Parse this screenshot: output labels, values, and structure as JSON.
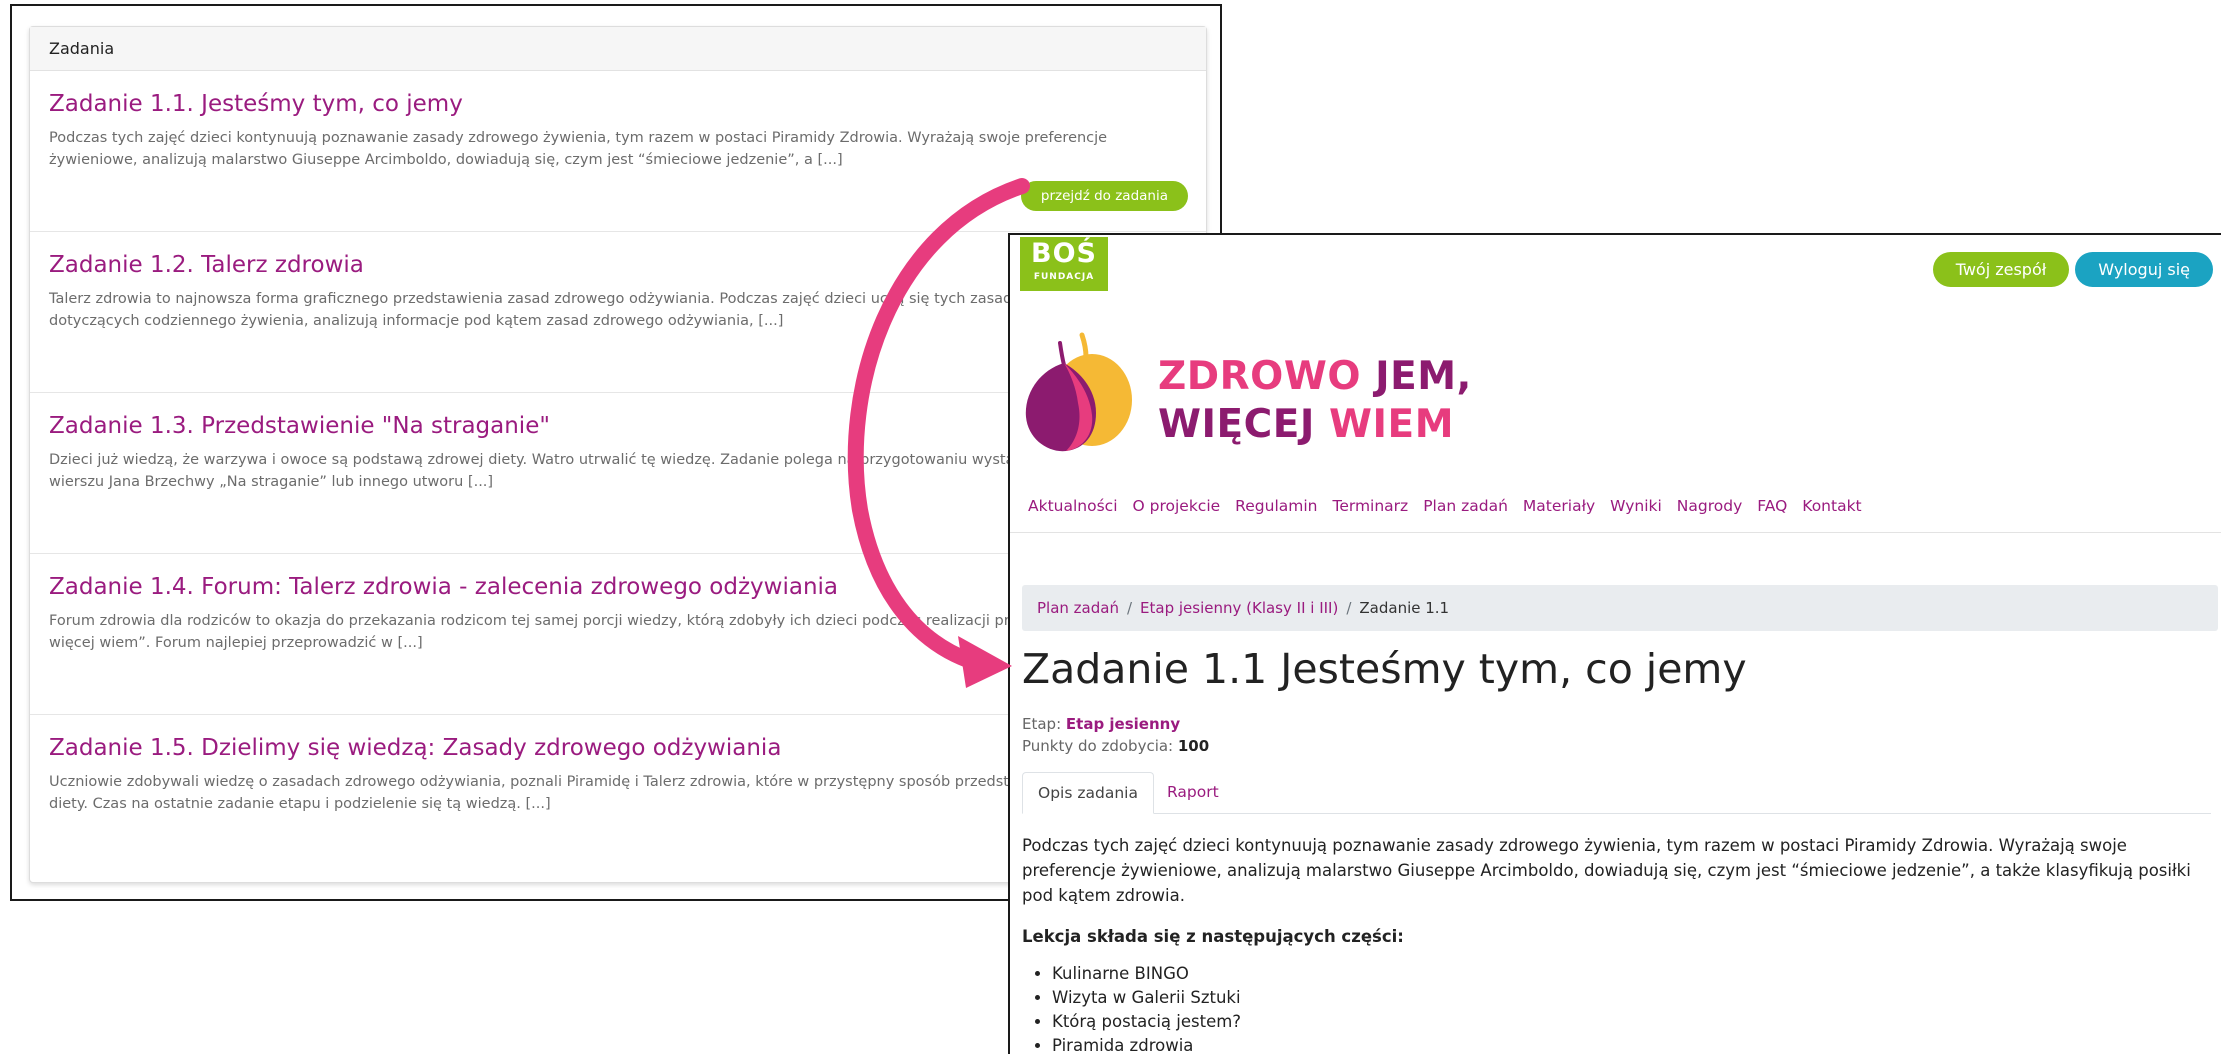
{
  "task_list": {
    "header": "Zadania",
    "goto_label": "przejdź do zadania",
    "items": [
      {
        "title": "Zadanie 1.1. Jesteśmy tym, co jemy",
        "desc": "Podczas tych zajęć dzieci kontynuują poznawanie zasady zdrowego żywienia, tym razem w postaci Piramidy Zdrowia. Wyrażają swoje preferencje żywieniowe, analizują malarstwo Giuseppe Arcimboldo, dowiadują się, czym jest “śmieciowe jedzenie”, a [...]"
      },
      {
        "title": "Zadanie 1.2. Talerz zdrowia",
        "desc": "Talerz zdrowia to najnowsza forma graficznego przedstawienia zasad zdrowego odżywiania. Podczas zajęć dzieci uczą się tych zasad, właściwych wyborów dotyczących codziennego żywienia, analizują informacje pod kątem zasad zdrowego odżywiania, [...]"
      },
      {
        "title": "Zadanie 1.3. Przedstawienie \"Na straganie\"",
        "desc": "Dzieci już wiedzą, że warzywa i owoce są podstawą zdrowej diety. Watro utrwalić tę wiedzę.  Zadanie polega na przygotowaniu wystąpienia na podstawie wierszu Jana Brzechwy „Na straganie” lub innego utworu [...]"
      },
      {
        "title": "Zadanie 1.4. Forum: Talerz zdrowia - zalecenia zdrowego odżywiania",
        "desc": "Forum zdrowia dla rodziców to okazja do przekazania rodzicom tej samej porcji wiedzy, którą zdobyły ich dzieci podczas realizacji projektu „Zdrowo jem, więcej wiem”. Forum najlepiej przeprowadzić w [...]"
      },
      {
        "title": "Zadanie 1.5. Dzielimy się wiedzą: Zasady zdrowego odżywiania",
        "desc": "Uczniowie zdobywali wiedzę o zasadach zdrowego odżywiania, poznali Piramidę i Talerz zdrowia, które w przystępny sposób przedstawiają zasady zdrowej diety.  Czas na ostatnie zadanie etapu i podzielenie się tą wiedzą. [...]"
      }
    ]
  },
  "detail": {
    "bos_logo": {
      "main": "BOŚ",
      "sub": "FUNDACJA"
    },
    "team_button": "Twój zespół",
    "logout_button": "Wyloguj się",
    "brand": {
      "line1_a": "ZDROWO ",
      "line1_b": "JEM,",
      "line2_a": "WIĘCEJ ",
      "line2_b": "WIEM"
    },
    "nav": [
      "Aktualności",
      "O projekcie",
      "Regulamin",
      "Terminarz",
      "Plan zadań",
      "Materiały",
      "Wyniki",
      "Nagrody",
      "FAQ",
      "Kontakt"
    ],
    "breadcrumb": [
      "Plan zadań",
      "Etap jesienny (Klasy II i III)",
      "Zadanie 1.1"
    ],
    "title": "Zadanie 1.1 Jesteśmy tym, co jemy",
    "stage_label": "Etap: ",
    "stage_value": "Etap jesienny",
    "points_label": "Punkty do zdobycia: ",
    "points_value": "100",
    "tabs": [
      "Opis zadania",
      "Raport"
    ],
    "description": "Podczas tych zajęć dzieci kontynuują poznawanie zasady zdrowego żywienia, tym razem w postaci Piramidy Zdrowia. Wyrażają swoje preferencje żywieniowe, analizują malarstwo Giuseppe Arcimboldo, dowiadują się, czym jest “śmieciowe jedzenie”, a także klasyfikują posiłki pod kątem zdrowia.",
    "lesson_heading": "Lekcja składa się z następujących części:",
    "lesson_parts": [
      "Kulinarne BINGO",
      "Wizyta w Galerii Sztuki",
      "Którą postacią jestem?",
      "Piramida zdrowia"
    ]
  },
  "colors": {
    "accent_purple": "#9a1b7f",
    "green": "#8bc11a",
    "teal": "#1ba3c2",
    "arrow": "#e73c7e"
  }
}
